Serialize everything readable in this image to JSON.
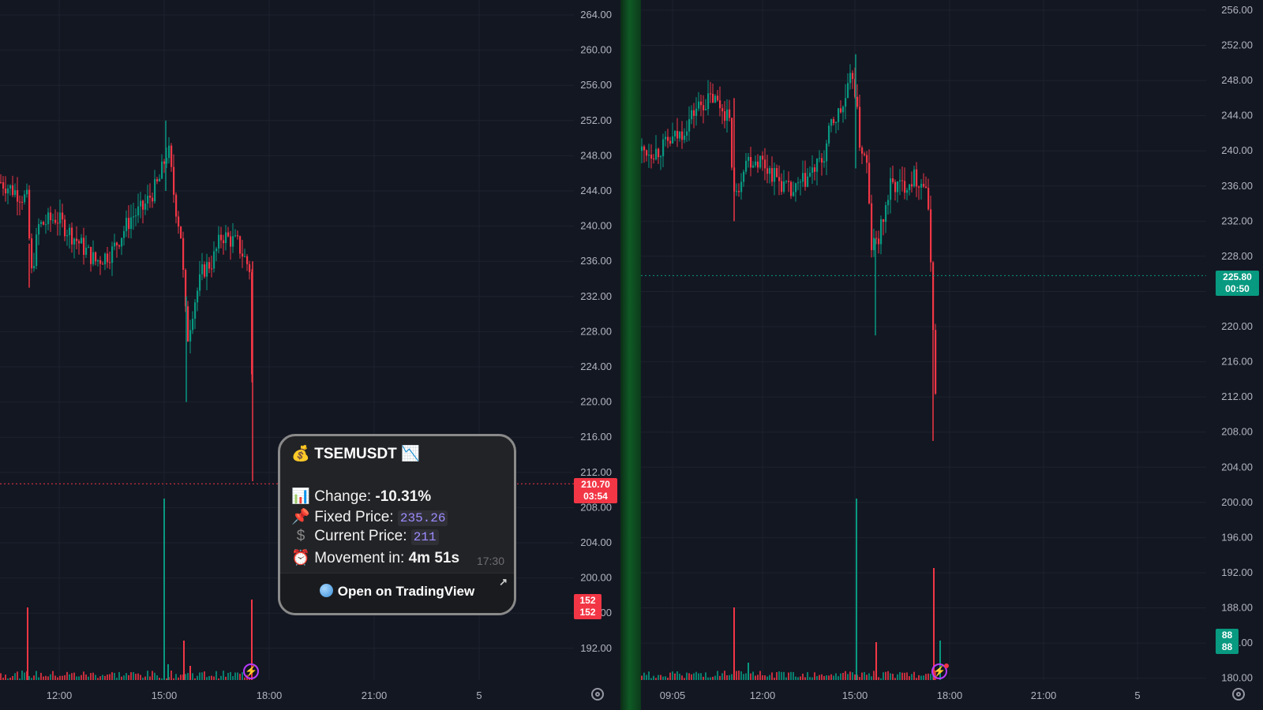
{
  "left_chart": {
    "y_ticks": [
      "264.00",
      "260.00",
      "256.00",
      "252.00",
      "248.00",
      "244.00",
      "240.00",
      "236.00",
      "232.00",
      "228.00",
      "224.00",
      "220.00",
      "216.00",
      "212.00",
      "208.00",
      "204.00",
      "200.00",
      "196.00",
      "192.00"
    ],
    "x_ticks": [
      "12:00",
      "15:00",
      "18:00",
      "21:00",
      "5"
    ],
    "price_label": {
      "price": "210.70",
      "countdown": "03:54"
    },
    "volume_label": {
      "top": "152",
      "bottom": "152"
    }
  },
  "right_chart": {
    "y_ticks": [
      "256.00",
      "252.00",
      "248.00",
      "244.00",
      "240.00",
      "236.00",
      "232.00",
      "228.00",
      "224.00",
      "220.00",
      "216.00",
      "212.00",
      "208.00",
      "204.00",
      "200.00",
      "196.00",
      "192.00",
      "188.00",
      "184.00",
      "180.00"
    ],
    "x_ticks": [
      "09:05",
      "12:00",
      "15:00",
      "18:00",
      "21:00",
      "5"
    ],
    "price_label": {
      "price": "225.80",
      "countdown": "00:50"
    },
    "volume_label": {
      "top": "88",
      "bottom": "88"
    }
  },
  "colors": {
    "up": "#089981",
    "down": "#f23645",
    "background": "#131722",
    "grid": "#1e222d",
    "axis_text": "#b2b5be"
  },
  "popup": {
    "title": "TSEMUSDT",
    "change_label": "Change:",
    "change_value": "-10.31%",
    "fixed_label": "Fixed Price:",
    "fixed_value": "235.26",
    "current_label": "Current Price:",
    "current_value": "211",
    "movement_label": "Movement in:",
    "movement_value": "4m 51s",
    "time": "17:30",
    "button_label": "Open on TradingView",
    "icons": [
      "money-bag-icon",
      "chart-down-icon",
      "bar-chart-icon",
      "pushpin-icon",
      "dollar-icon",
      "alarm-clock-icon",
      "globe-icon"
    ]
  }
}
